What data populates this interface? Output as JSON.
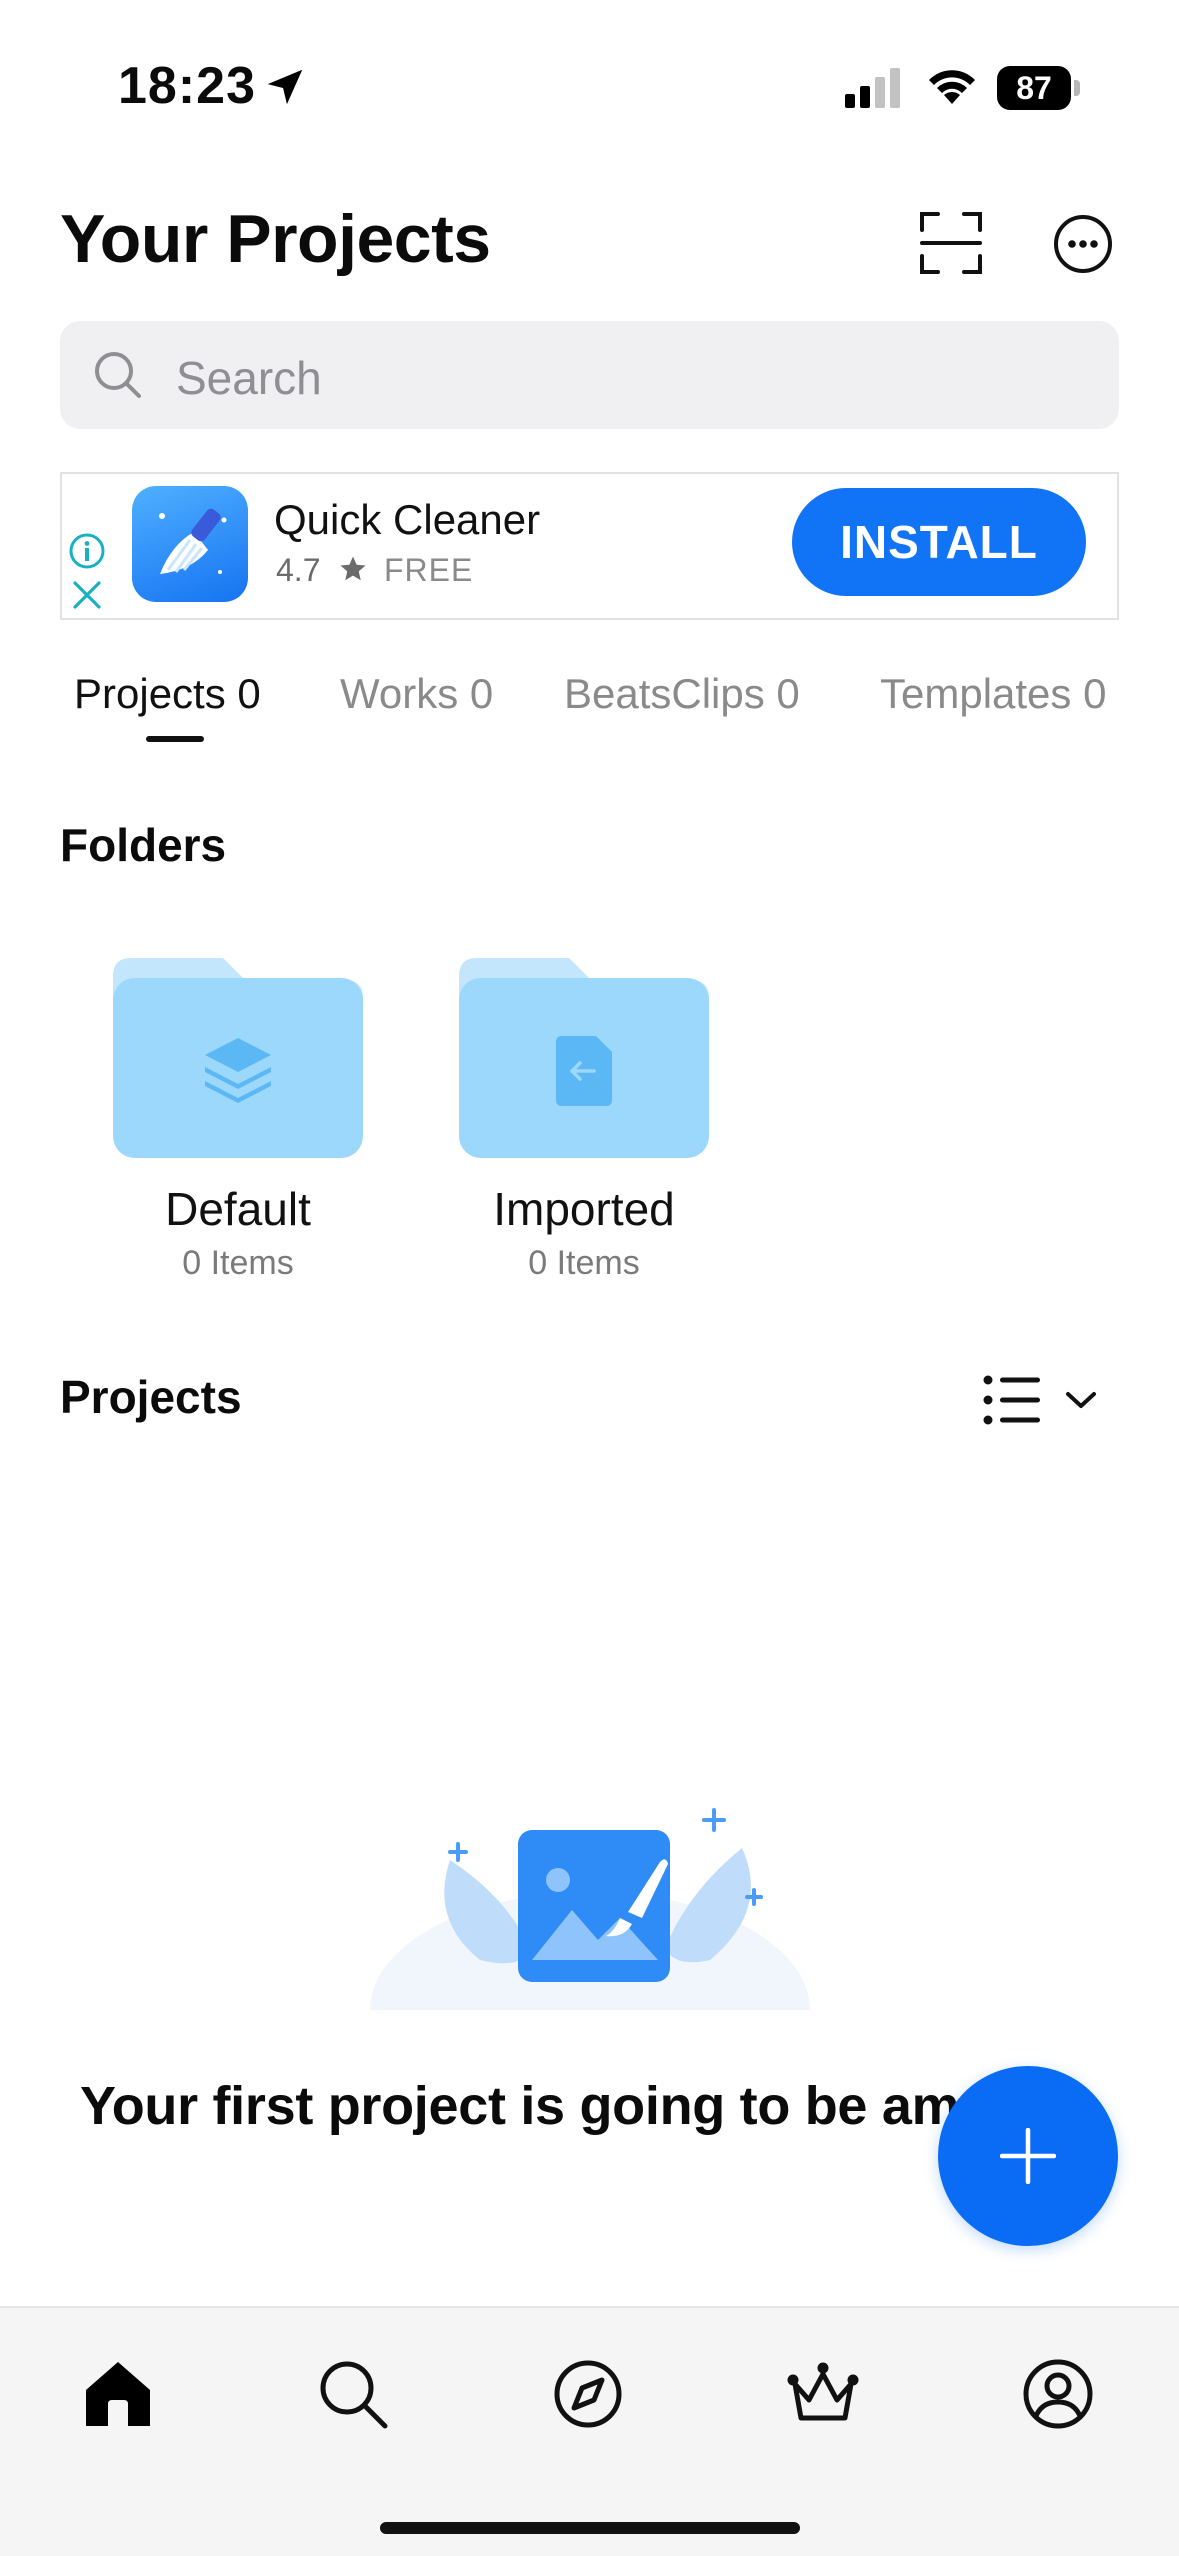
{
  "status_bar": {
    "time": "18:23",
    "battery": "87"
  },
  "header": {
    "title": "Your Projects",
    "icons": [
      "scan-icon",
      "more-icon"
    ]
  },
  "search": {
    "placeholder": "Search"
  },
  "ad": {
    "app_name": "Quick Cleaner",
    "rating": "4.7",
    "price": "FREE",
    "install_label": "INSTALL",
    "accent_color": "#1173f5"
  },
  "tabs": [
    {
      "label": "Projects 0",
      "active": true
    },
    {
      "label": "Works 0",
      "active": false
    },
    {
      "label": "BeatsClips 0",
      "active": false
    },
    {
      "label": "Templates 0",
      "active": false
    }
  ],
  "folders": {
    "title": "Folders",
    "items": [
      {
        "name": "Default",
        "count": "0 Items",
        "icon": "layers-icon"
      },
      {
        "name": "Imported",
        "count": "0 Items",
        "icon": "import-file-icon"
      }
    ]
  },
  "projects": {
    "title": "Projects",
    "empty_text": "Your first project is going to be am"
  },
  "bottom_nav": {
    "items": [
      "home-icon",
      "search-icon",
      "explore-icon",
      "crown-icon",
      "profile-icon"
    ],
    "active": "home-icon"
  }
}
